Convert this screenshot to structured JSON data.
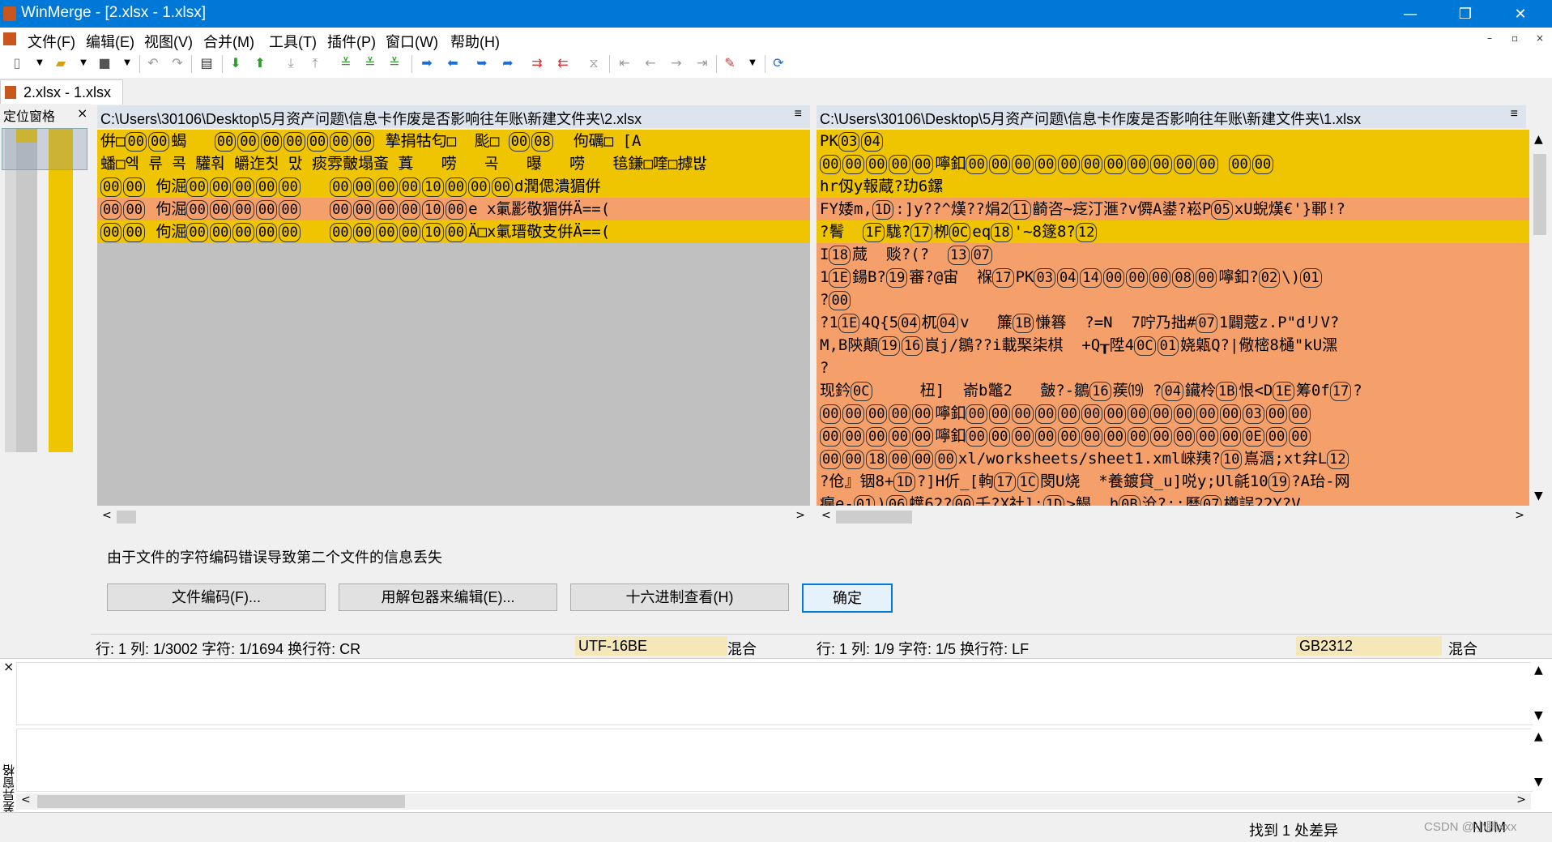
{
  "window": {
    "title": "WinMerge - [2.xlsx - 1.xlsx]",
    "minimize": "—",
    "maximize": "❐",
    "close": "✕"
  },
  "menu": {
    "items": [
      "文件(F)",
      "编辑(E)",
      "视图(V)",
      "合并(M)",
      "工具(T)",
      "插件(P)",
      "窗口(W)",
      "帮助(H)"
    ],
    "mdi_minimize": "–",
    "mdi_restore": "▫",
    "mdi_close": "×"
  },
  "tab": {
    "label": "2.xlsx - 1.xlsx"
  },
  "location_pane": {
    "title": "定位窗格",
    "close": "×"
  },
  "left": {
    "path": "C:\\Users\\30106\\Desktop\\5月资产问题\\信息卡作废是否影响往年账\\新建文件夹\\2.xlsx",
    "menu_glyph": "≡",
    "lines": [
      [
        {
          "t": "倂□"
        },
        {
          "h": "00"
        },
        {
          "h": "00"
        },
        {
          "t": "蝎   "
        },
        {
          "h": "00"
        },
        {
          "h": "00"
        },
        {
          "h": "00"
        },
        {
          "h": "00"
        },
        {
          "h": "00"
        },
        {
          "h": "00"
        },
        {
          "h": "00"
        },
        {
          "t": " 摯捐牯匂□  颩□ "
        },
        {
          "h": "00"
        },
        {
          "h": "08"
        },
        {
          "t": "  佝礪□ [A"
        }
      ],
      [
        {
          "t": "蟠□엑 류 콕 驩훠 皭迮칫 맜 痰雰皾塌蚉 蒖   唠   곡   曝   唠   毰鎌□喹□摢밚"
        }
      ],
      [
        {
          "h": "00"
        },
        {
          "h": "00"
        },
        {
          "t": " 佝淈"
        },
        {
          "h": "00"
        },
        {
          "h": "00"
        },
        {
          "h": "00"
        },
        {
          "h": "00"
        },
        {
          "h": "00"
        },
        {
          "t": "   "
        },
        {
          "h": "00"
        },
        {
          "h": "00"
        },
        {
          "h": "00"
        },
        {
          "h": "00"
        },
        {
          "h": "10"
        },
        {
          "h": "00"
        },
        {
          "h": "00"
        },
        {
          "h": "00"
        },
        {
          "t": "d潤偲潰猸倂"
        }
      ],
      [
        {
          "h": "00"
        },
        {
          "h": "00"
        },
        {
          "t": " 佝淈"
        },
        {
          "h": "00"
        },
        {
          "h": "00"
        },
        {
          "h": "00"
        },
        {
          "h": "00"
        },
        {
          "h": "00"
        },
        {
          "t": "   "
        },
        {
          "h": "00"
        },
        {
          "h": "00"
        },
        {
          "h": "00"
        },
        {
          "h": "00"
        },
        {
          "h": "10"
        },
        {
          "h": "00"
        },
        {
          "t": "e x氭彲敬猸倂Ä==("
        }
      ],
      [
        {
          "h": "00"
        },
        {
          "h": "00"
        },
        {
          "t": " 佝淈"
        },
        {
          "h": "00"
        },
        {
          "h": "00"
        },
        {
          "h": "00"
        },
        {
          "h": "00"
        },
        {
          "h": "00"
        },
        {
          "t": "   "
        },
        {
          "h": "00"
        },
        {
          "h": "00"
        },
        {
          "h": "00"
        },
        {
          "h": "00"
        },
        {
          "h": "10"
        },
        {
          "h": "00"
        },
        {
          "t": "Ä□x氭瑨敬支倂Ä==("
        }
      ]
    ],
    "line_colors": [
      "#efc400",
      "#efc400",
      "#efc400",
      "#f5a06a",
      "#efc400"
    ]
  },
  "right": {
    "path": "C:\\Users\\30106\\Desktop\\5月资产问题\\信息卡作废是否影响往年账\\新建文件夹\\1.xlsx",
    "menu_glyph": "≡",
    "lines": [
      [
        {
          "t": "PK"
        },
        {
          "h": "03"
        },
        {
          "h": "04"
        }
      ],
      [
        {
          "h": "00"
        },
        {
          "h": "00"
        },
        {
          "h": "00"
        },
        {
          "h": "00"
        },
        {
          "h": "00"
        },
        {
          "t": "嚀釦"
        },
        {
          "h": "00"
        },
        {
          "h": "00"
        },
        {
          "h": "00"
        },
        {
          "h": "00"
        },
        {
          "h": "00"
        },
        {
          "h": "00"
        },
        {
          "h": "00"
        },
        {
          "h": "00"
        },
        {
          "h": "00"
        },
        {
          "h": "00"
        },
        {
          "h": "00"
        },
        {
          "t": " "
        },
        {
          "h": "00"
        },
        {
          "h": "00"
        }
      ],
      [
        {
          "t": "hr仭y報蔵?玏6鏍"
        }
      ],
      [
        {
          "t": "FY婑m,"
        },
        {
          "h": "1D"
        },
        {
          "t": ":]y??^熯??焆2"
        },
        {
          "h": "11"
        },
        {
          "t": "齮咨~疺汀滙?v僲A鍙?崧P"
        },
        {
          "h": "05"
        },
        {
          "t": "xU蜺熯€'}鄆!?"
        }
      ],
      [
        {
          "t": "?鬌  "
        },
        {
          "h": "1F"
        },
        {
          "t": "駹?"
        },
        {
          "h": "17"
        },
        {
          "t": "栁"
        },
        {
          "h": "0C"
        },
        {
          "t": "eq"
        },
        {
          "h": "18"
        },
        {
          "t": "'~8篴8?"
        },
        {
          "h": "12"
        }
      ],
      [
        {
          "t": "I"
        },
        {
          "h": "18"
        },
        {
          "t": "蒇  赕?(?  "
        },
        {
          "h": "13"
        },
        {
          "h": "07"
        }
      ],
      [
        {
          "t": "1"
        },
        {
          "h": "1E"
        },
        {
          "t": "鍚B?"
        },
        {
          "h": "19"
        },
        {
          "t": "審?@宙  褓"
        },
        {
          "h": "17"
        },
        {
          "t": "PK"
        },
        {
          "h": "03"
        },
        {
          "h": "04"
        },
        {
          "h": "14"
        },
        {
          "h": "00"
        },
        {
          "h": "00"
        },
        {
          "h": "00"
        },
        {
          "h": "08"
        },
        {
          "h": "00"
        },
        {
          "t": "嚀釦?"
        },
        {
          "h": "02"
        },
        {
          "t": "\\)"
        },
        {
          "h": "01"
        }
      ],
      [
        {
          "t": "?"
        },
        {
          "h": "00"
        }
      ],
      [
        {
          "t": "?1"
        },
        {
          "h": "1E"
        },
        {
          "t": "4Q{5"
        },
        {
          "h": "04"
        },
        {
          "t": "杌"
        },
        {
          "h": "04"
        },
        {
          "t": "v   簾"
        },
        {
          "h": "1B"
        },
        {
          "t": "慊簭  ?=N  7咛乃拙#"
        },
        {
          "h": "07"
        },
        {
          "t": "1闢蔲z.P\"dリV?"
        }
      ],
      [
        {
          "t": "M,B陝顛"
        },
        {
          "h": "19"
        },
        {
          "h": "16"
        },
        {
          "t": "峎j/鶵??i載棸柒棋  +Q┰陞4"
        },
        {
          "h": "0C"
        },
        {
          "h": "01"
        },
        {
          "t": "娆甈Q?|儆樒8樋\"kU潶"
        }
      ],
      [
        {
          "t": "?"
        }
      ],
      [
        {
          "t": "现鈐"
        },
        {
          "h": "0C"
        },
        {
          "t": "     杻]  嵛b鼈2   皼?-鶵"
        },
        {
          "h": "16"
        },
        {
          "t": "蒺⒆ ?"
        },
        {
          "h": "04"
        },
        {
          "t": "鑶柃"
        },
        {
          "h": "1B"
        },
        {
          "t": "恨<D"
        },
        {
          "h": "1E"
        },
        {
          "t": "筹0f"
        },
        {
          "h": "17"
        },
        {
          "t": "?"
        }
      ],
      [
        {
          "h": "00"
        },
        {
          "h": "00"
        },
        {
          "h": "00"
        },
        {
          "h": "00"
        },
        {
          "h": "00"
        },
        {
          "t": "嚀釦"
        },
        {
          "h": "00"
        },
        {
          "h": "00"
        },
        {
          "h": "00"
        },
        {
          "h": "00"
        },
        {
          "h": "00"
        },
        {
          "h": "00"
        },
        {
          "h": "00"
        },
        {
          "h": "00"
        },
        {
          "h": "00"
        },
        {
          "h": "00"
        },
        {
          "h": "00"
        },
        {
          "h": "00"
        },
        {
          "h": "03"
        },
        {
          "h": "00"
        },
        {
          "h": "00"
        }
      ],
      [
        {
          "h": "00"
        },
        {
          "h": "00"
        },
        {
          "h": "00"
        },
        {
          "h": "00"
        },
        {
          "h": "00"
        },
        {
          "t": "嚀釦"
        },
        {
          "h": "00"
        },
        {
          "h": "00"
        },
        {
          "h": "00"
        },
        {
          "h": "00"
        },
        {
          "h": "00"
        },
        {
          "h": "00"
        },
        {
          "h": "00"
        },
        {
          "h": "00"
        },
        {
          "h": "00"
        },
        {
          "h": "00"
        },
        {
          "h": "00"
        },
        {
          "h": "00"
        },
        {
          "h": "0E"
        },
        {
          "h": "00"
        },
        {
          "h": "00"
        }
      ],
      [
        {
          "h": "00"
        },
        {
          "h": "00"
        },
        {
          "h": "18"
        },
        {
          "h": "00"
        },
        {
          "h": "00"
        },
        {
          "h": "00"
        },
        {
          "t": "xl/worksheets/sheet1.xml崍羠?"
        },
        {
          "h": "10"
        },
        {
          "t": "嶌滣;xt弅L"
        },
        {
          "h": "12"
        }
      ],
      [
        {
          "t": "?伧』铟8+"
        },
        {
          "h": "1D"
        },
        {
          "t": "?]H伒_[軥"
        },
        {
          "h": "17"
        },
        {
          "h": "1C"
        },
        {
          "t": "閔U烧  *養鍍貸_u]哾y;Ul毹10"
        },
        {
          "h": "19"
        },
        {
          "t": "?A珆-网"
        }
      ],
      [
        {
          "t": "瘺e-"
        },
        {
          "h": "01"
        },
        {
          "t": ")"
        },
        {
          "h": "06"
        },
        {
          "t": "蠂62?"
        },
        {
          "h": "00"
        },
        {
          "t": "壬?X社]:"
        },
        {
          "h": "1D"
        },
        {
          "t": ">鳎  h"
        },
        {
          "h": "0B"
        },
        {
          "t": "沧?:;曆"
        },
        {
          "h": "07"
        },
        {
          "t": "樽誤22Y?V"
        }
      ]
    ],
    "line_colors": [
      "#efc400",
      "#efc400",
      "#efc400",
      "#f5a06a",
      "#efc400",
      "#f5a06a",
      "#f5a06a",
      "#f5a06a",
      "#f5a06a",
      "#f5a06a",
      "#f5a06a",
      "#f5a06a",
      "#f5a06a",
      "#f5a06a",
      "#f5a06a",
      "#f5a06a",
      "#f5a06a"
    ]
  },
  "message": "由于文件的字符编码错误导致第二个文件的信息丢失",
  "buttons": {
    "file_encoding": "文件编码(F)...",
    "unpacker": "用解包器来编辑(E)...",
    "hex_view": "十六进制查看(H)",
    "ok": "确定"
  },
  "status_left": {
    "position": "行: 1  列: 1/3002  字符: 1/1694  换行符: CR",
    "encoding": "UTF-16BE",
    "mode": "混合"
  },
  "status_right": {
    "position": "行: 1  列: 1/9  字符: 1/5  换行符: LF",
    "encoding": "GB2312",
    "mode": "混合"
  },
  "diff_pane": {
    "title": "差异窗格",
    "close": "×"
  },
  "bottom_status": {
    "diff_count": "找到 1 处差异",
    "num": "NUM",
    "watermark": "CSDN @小鹏xxx"
  },
  "colors": {
    "titlebar": "#0078d7",
    "diff_yellow": "#efc400",
    "diff_orange": "#f5a06a",
    "empty_gray": "#c0c0c0"
  }
}
